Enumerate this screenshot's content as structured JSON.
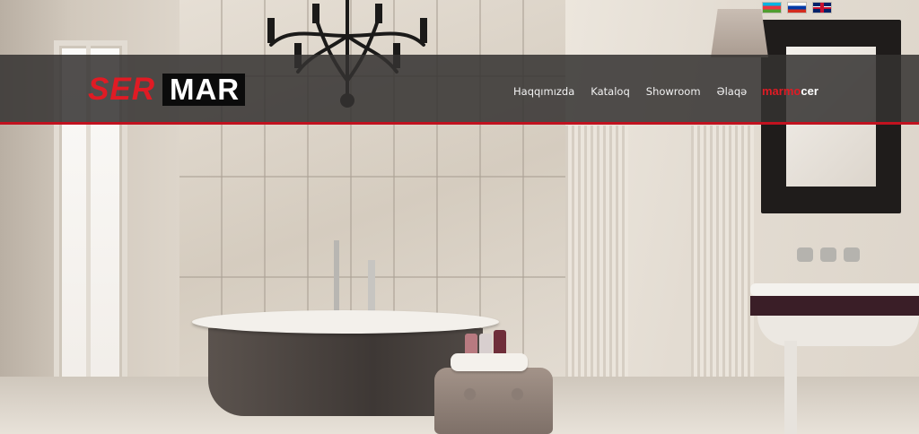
{
  "header": {
    "logo": {
      "part1": "SER",
      "part2": "MAR"
    },
    "nav": [
      {
        "label": "Haqqımızda"
      },
      {
        "label": "Kataloq"
      },
      {
        "label": "Showroom"
      },
      {
        "label": "Əlaqə"
      }
    ],
    "partner_brand": {
      "part1": "marmo",
      "part2": "cer"
    }
  },
  "languages": [
    {
      "icon": "flag-az-icon"
    },
    {
      "icon": "flag-ru-icon"
    },
    {
      "icon": "flag-gb-icon"
    }
  ],
  "colors": {
    "accent": "#c1121f",
    "logo_red": "#e01b24",
    "header_bg": "#343231"
  }
}
